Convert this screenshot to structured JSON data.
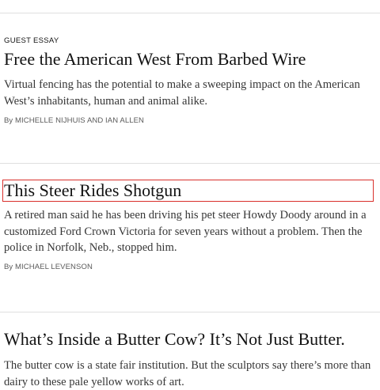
{
  "articles": [
    {
      "kicker": "Guest Essay",
      "headline": "Free the American West From Barbed Wire",
      "summary": "Virtual fencing has the potential to make a sweeping impact on the American West’s inhabitants, human and animal alike.",
      "byline_prefix": "By",
      "byline": "Michelle Nijhuis and Ian Allen"
    },
    {
      "headline": "This Steer Rides Shotgun",
      "summary": "A retired man said he has been driving his pet steer Howdy Doody around in a customized Ford Crown Victoria for seven years without a problem. Then the police in Norfolk, Neb., stopped him.",
      "byline_prefix": "By",
      "byline": "Michael Levenson"
    },
    {
      "headline": "What’s Inside a Butter Cow? It’s Not Just Butter.",
      "summary": "The butter cow is a state fair institution. But the sculptors say there’s more than dairy to these pale yellow works of art."
    }
  ],
  "colors": {
    "focus_outline": "#d9302c",
    "divider": "#dfdfdf",
    "headline": "#121212",
    "summary": "#363636",
    "byline": "#5a5a5a"
  }
}
